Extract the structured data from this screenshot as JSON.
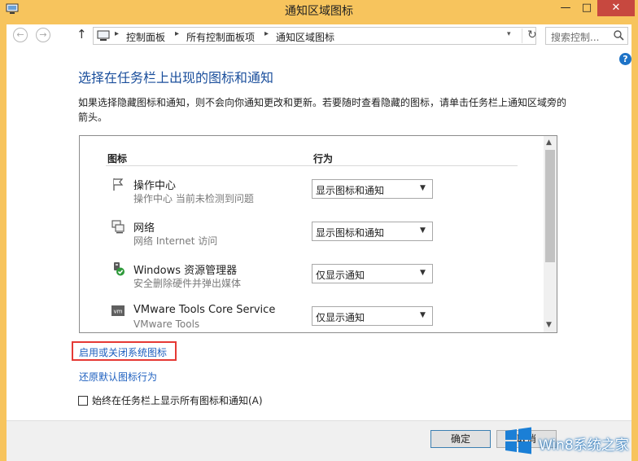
{
  "window": {
    "title": "通知区域图标"
  },
  "controls": {
    "minimize": "—",
    "maximize": "□",
    "close": "✕"
  },
  "nav": {
    "back": "←",
    "forward": "→",
    "up": "↑",
    "breadcrumbs": [
      "控制面板",
      "所有控制面板项",
      "通知区域图标"
    ],
    "dropdown": "▾",
    "refresh": "↻",
    "search_placeholder": "搜索控制..."
  },
  "help": "?",
  "main": {
    "heading": "选择在任务栏上出现的图标和通知",
    "description": "如果选择隐藏图标和通知，则不会向你通知更改和更新。若要随时查看隐藏的图标，请单击任务栏上通知区域旁的箭头。",
    "columns": {
      "icon": "图标",
      "behavior": "行为"
    },
    "rows": [
      {
        "icon": "flag-icon",
        "name": "操作中心",
        "sub": "操作中心  当前未检测到问题",
        "behavior": "显示图标和通知"
      },
      {
        "icon": "network-icon",
        "name": "网络",
        "sub": "网络 Internet 访问",
        "behavior": "显示图标和通知"
      },
      {
        "icon": "safely-remove-hardware-icon",
        "name": "Windows 资源管理器",
        "sub": "安全删除硬件并弹出媒体",
        "behavior": "仅显示通知"
      },
      {
        "icon": "vmware-icon",
        "name": "VMware Tools Core Service",
        "sub": "VMware Tools",
        "behavior": "仅显示通知"
      }
    ],
    "links": {
      "toggle_system_icons": "启用或关闭系统图标",
      "restore_defaults": "还原默认图标行为"
    },
    "always_show": {
      "label": "始终在任务栏上显示所有图标和通知(A)",
      "checked": false
    }
  },
  "footer": {
    "ok": "确定",
    "cancel": "取消"
  },
  "watermark": {
    "text": "Win8系统之家"
  },
  "colors": {
    "accent": "#1b4f9c",
    "highlight_box": "#e53935",
    "frame": "#f7c45d",
    "close": "#c7483f"
  }
}
